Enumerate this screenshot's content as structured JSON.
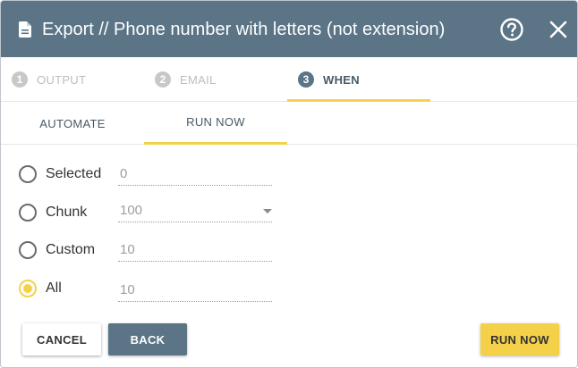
{
  "header": {
    "title": "Export // Phone number with letters (not extension)",
    "icons": {
      "document": "document-icon",
      "help": "help-icon",
      "close": "close-icon"
    }
  },
  "stepper": {
    "steps": [
      {
        "number": "1",
        "label": "OUTPUT",
        "active": false
      },
      {
        "number": "2",
        "label": "EMAIL",
        "active": false
      },
      {
        "number": "3",
        "label": "WHEN",
        "active": true
      }
    ]
  },
  "subtabs": [
    {
      "label": "AUTOMATE",
      "active": false
    },
    {
      "label": "RUN NOW",
      "active": true
    }
  ],
  "options": {
    "selected": {
      "label": "Selected",
      "value": "0",
      "checked": false
    },
    "chunk": {
      "label": "Chunk",
      "value": "100",
      "checked": false
    },
    "custom": {
      "label": "Custom",
      "value": "10",
      "checked": false
    },
    "all": {
      "label": "All",
      "value": "10",
      "checked": true
    }
  },
  "buttons": {
    "cancel": "CANCEL",
    "back": "BACK",
    "run_now": "RUN NOW"
  },
  "colors": {
    "header_bg": "#5b7486",
    "accent": "#f5d14a",
    "muted": "#bdbdbd"
  }
}
